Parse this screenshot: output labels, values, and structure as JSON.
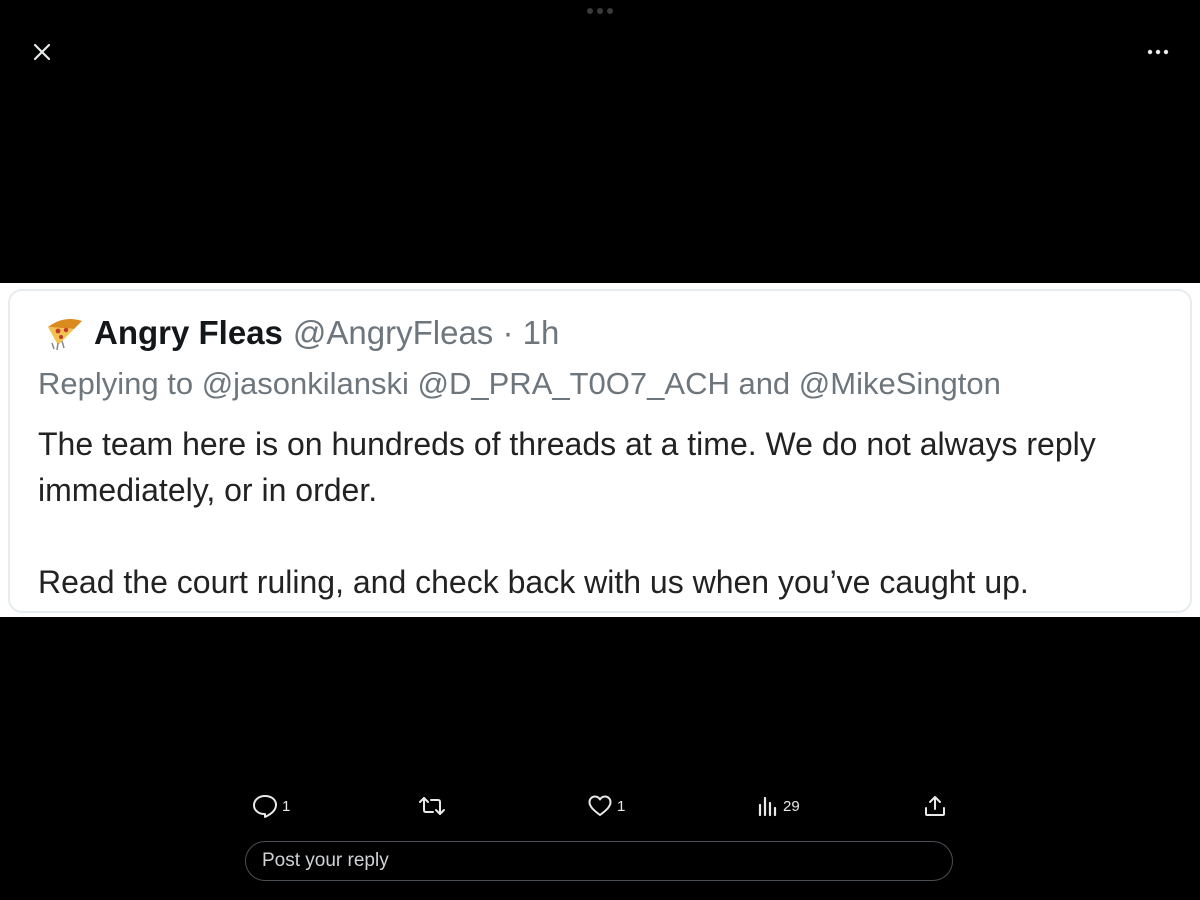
{
  "viewer": {
    "close_icon": "close-icon",
    "more_icon": "more-horizontal-icon"
  },
  "tweet": {
    "avatar_icon": "pizza-avatar-icon",
    "display_name": "Angry Fleas",
    "handle_time": "@AngryFleas · 1h",
    "replying_to": "Replying to @jasonkilanski @D_PRA_T0O7_ACH and @MikeSington",
    "paragraphs": [
      "The team here is on hundreds of threads at a time. We do not always reply immediately, or in order.",
      "Read the court ruling, and check back with us when you’ve caught up."
    ]
  },
  "actions": {
    "reply": {
      "icon": "reply-icon",
      "count": "1"
    },
    "retweet": {
      "icon": "retweet-icon",
      "count": ""
    },
    "like": {
      "icon": "heart-icon",
      "count": "1"
    },
    "views": {
      "icon": "views-chart-icon",
      "count": "29"
    },
    "share": {
      "icon": "share-icon",
      "count": ""
    }
  },
  "reply_box": {
    "placeholder": "Post your reply"
  },
  "colors": {
    "background": "#000000",
    "card": "#ffffff",
    "muted_text": "#6e767d",
    "icon": "#e7e9ea"
  }
}
